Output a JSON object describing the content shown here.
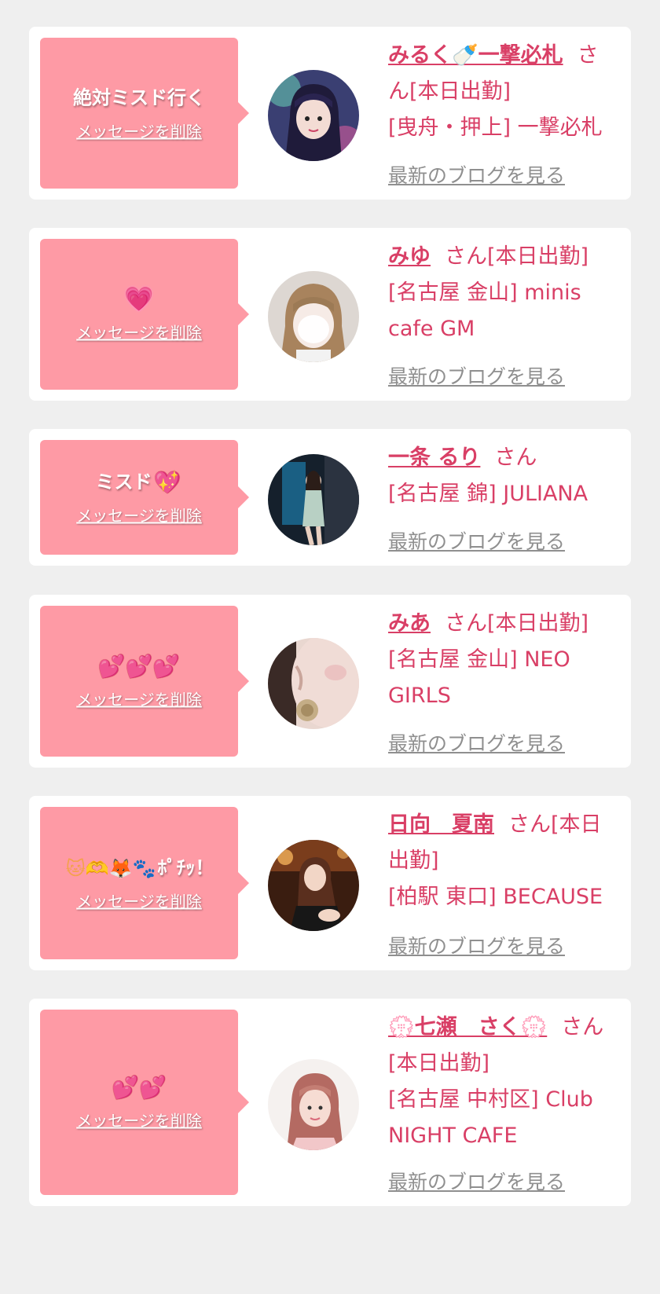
{
  "favorites": [
    {
      "message": "絶対ミスド行く",
      "delete_label": "メッセージを削除",
      "name": "みるく🍼一撃必札",
      "suffix": "さん[本日出勤]",
      "shop": "[曳舟・押上] 一撃必札",
      "blog_label": "最新のブログを見る"
    },
    {
      "message_emoji": "💗",
      "delete_label": "メッセージを削除",
      "name": "みゆ",
      "suffix": "さん[本日出勤]",
      "shop": "[名古屋 金山] minis cafe GM",
      "blog_label": "最新のブログを見る"
    },
    {
      "message": "ミスド",
      "message_emoji": "💖",
      "delete_label": "メッセージを削除",
      "name": "一条 るり",
      "suffix": "さん",
      "shop": "[名古屋 錦] JULIANA",
      "blog_label": "最新のブログを見る"
    },
    {
      "message_emoji": "💕💕💕",
      "delete_label": "メッセージを削除",
      "name": "みあ",
      "suffix": "さん[本日出勤]",
      "shop": "[名古屋 金山] NEO GIRLS",
      "blog_label": "最新のブログを見る"
    },
    {
      "message_emoji": "🐱🫶🦊🐾",
      "message": "ﾎﾟﾁｯ！",
      "delete_label": "メッセージを削除",
      "name": "日向　夏南",
      "suffix": "さん[本日出勤]",
      "shop": "[柏駅 東口] BECAUSE",
      "blog_label": "最新のブログを見る"
    },
    {
      "message_emoji": "💕💕",
      "delete_label": "メッセージを削除",
      "name": "💮七瀬　さく💮",
      "suffix": "さん[本日出勤]",
      "shop": "[名古屋 中村区] Club NIGHT CAFE",
      "blog_label": "最新のブログを見る"
    }
  ],
  "colors": {
    "page_bg": "#efefef",
    "card_bg": "#ffffff",
    "bubble_bg": "#fe9aa5",
    "accent": "#d93f66",
    "link_gray": "#8f8f8f"
  }
}
